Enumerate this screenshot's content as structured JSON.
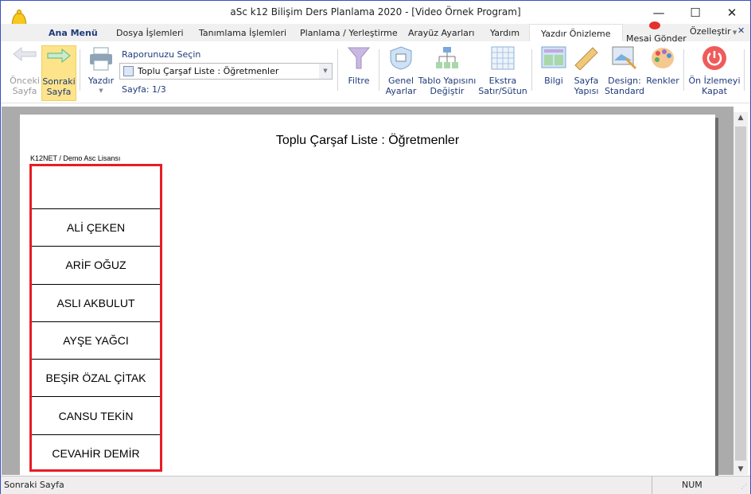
{
  "window": {
    "title": "aSc k12 Bilişim Ders Planlama 2020  - [Video Örnek Program]",
    "minimize": "—",
    "maximize": "☐",
    "close": "✕"
  },
  "tabs": [
    {
      "label": "Ana Menü"
    },
    {
      "label": "Dosya İşlemleri"
    },
    {
      "label": "Tanımlama İşlemleri"
    },
    {
      "label": "Planlama / Yerleştirme"
    },
    {
      "label": "Arayüz Ayarları"
    },
    {
      "label": "Yardım"
    },
    {
      "label": "Yazdır Önizleme",
      "active": true
    }
  ],
  "message_button": "Mesaj Gönder",
  "customize": "Özelleştir",
  "customize_close": "✕",
  "ribbon": {
    "prev": "Önceki Sayfa",
    "next": "Sonraki Sayfa",
    "print": "Yazdır",
    "report_label": "Raporunuzu Seçin",
    "report_value": "Toplu Çarşaf Liste : Öğretmenler",
    "page_info": "Sayfa: 1/3",
    "filter": "Filtre",
    "general": "Genel Ayarlar",
    "table": "Tablo Yapısını Değiştir",
    "extra": "Ekstra Satır/Sütun",
    "info": "Bilgi",
    "page_setup": "Sayfa Yapısı",
    "design": "Design: Standard",
    "colors": "Renkler",
    "close_preview": "Ön İzlemeyi Kapat"
  },
  "page": {
    "title": "Toplu Çarşaf Liste : Öğretmenler",
    "license": "K12NET / Demo Asc Lisansı",
    "rows": [
      "ALİ ÇEKEN",
      "ARİF OĞUZ",
      "ASLI AKBULUT",
      "AYŞE YAĞCI",
      "BEŞİR ÖZAL ÇİTAK",
      "CANSU TEKİN",
      "CEVAHİR DEMİR"
    ]
  },
  "status": {
    "left": "Sonraki Sayfa",
    "num": "NUM"
  },
  "colors": {
    "accent": "#fde48a",
    "border": "#e81c24",
    "window_border": "#3b4fc4"
  }
}
